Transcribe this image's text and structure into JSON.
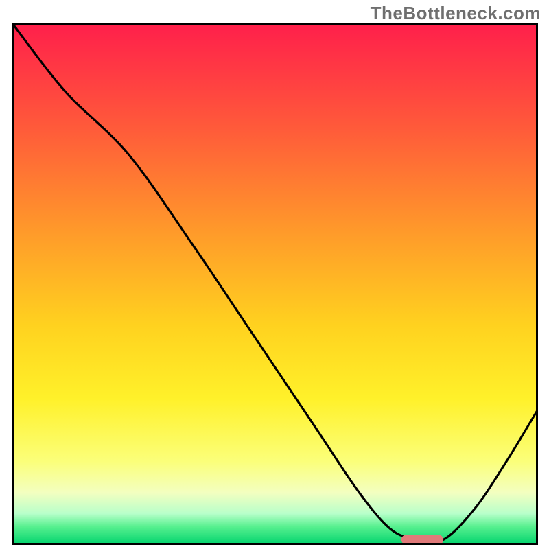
{
  "watermark": "TheBottleneck.com",
  "chart_data": {
    "type": "line",
    "title": "",
    "xlabel": "",
    "ylabel": "",
    "xlim": [
      0,
      100
    ],
    "ylim": [
      0,
      100
    ],
    "series": [
      {
        "name": "bottleneck-curve",
        "x": [
          0,
          10,
          22,
          34,
          46,
          58,
          66,
          72,
          77,
          82,
          88,
          94,
          100
        ],
        "y": [
          100,
          87,
          75,
          58,
          40,
          22,
          10,
          3,
          1,
          1,
          7,
          16,
          26
        ]
      }
    ],
    "marker": {
      "name": "optimal-range",
      "x_start": 74,
      "x_end": 82,
      "y": 1,
      "color": "#e07a7a"
    },
    "background_gradient": {
      "stops": [
        {
          "pos": 0.0,
          "color": "#ff1f4b"
        },
        {
          "pos": 0.2,
          "color": "#ff5a3a"
        },
        {
          "pos": 0.4,
          "color": "#ff9a2a"
        },
        {
          "pos": 0.58,
          "color": "#ffd21f"
        },
        {
          "pos": 0.72,
          "color": "#fff12a"
        },
        {
          "pos": 0.84,
          "color": "#fbff7a"
        },
        {
          "pos": 0.9,
          "color": "#f3ffc0"
        },
        {
          "pos": 0.94,
          "color": "#b8ffca"
        },
        {
          "pos": 0.965,
          "color": "#57f08f"
        },
        {
          "pos": 1.0,
          "color": "#00d36d"
        }
      ]
    },
    "border_color": "#000000"
  }
}
